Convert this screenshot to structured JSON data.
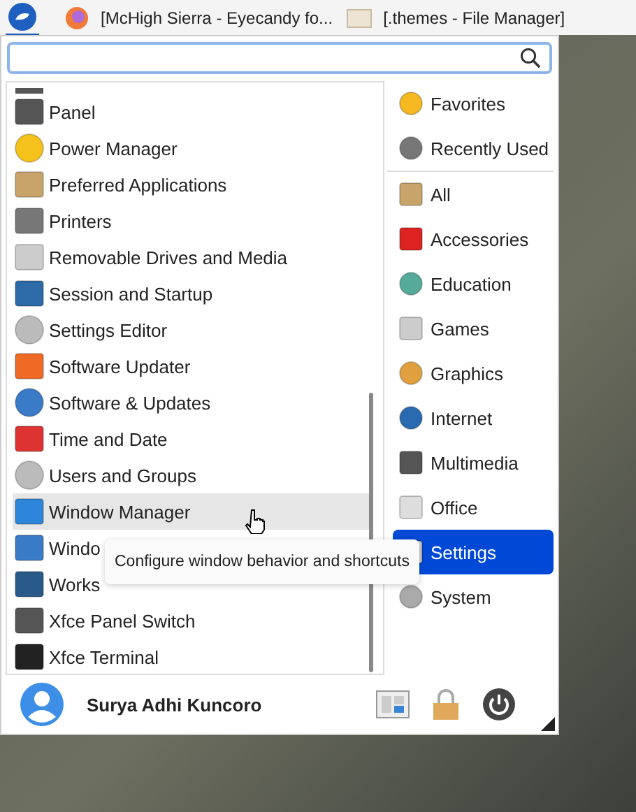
{
  "taskbar": {
    "windows": [
      {
        "title": "[McHigh Sierra - Eyecandy fo..."
      },
      {
        "title": "[.themes - File Manager]"
      }
    ]
  },
  "search": {
    "focused": true
  },
  "apps": [
    {
      "label": "Panel",
      "hovered": false
    },
    {
      "label": "Power Manager",
      "hovered": false
    },
    {
      "label": "Preferred Applications",
      "hovered": false
    },
    {
      "label": "Printers",
      "hovered": false
    },
    {
      "label": "Removable Drives and Media",
      "hovered": false
    },
    {
      "label": "Session and Startup",
      "hovered": false
    },
    {
      "label": "Settings Editor",
      "hovered": false
    },
    {
      "label": "Software Updater",
      "hovered": false
    },
    {
      "label": "Software & Updates",
      "hovered": false
    },
    {
      "label": "Time and Date",
      "hovered": false
    },
    {
      "label": "Users and Groups",
      "hovered": false
    },
    {
      "label": "Window Manager",
      "hovered": true
    },
    {
      "label": "Windo",
      "hovered": false
    },
    {
      "label": "Works",
      "hovered": false
    },
    {
      "label": "Xfce Panel Switch",
      "hovered": false
    },
    {
      "label": "Xfce Terminal",
      "hovered": false
    }
  ],
  "tooltip": "Configure window behavior and shortcuts",
  "categories": [
    {
      "label": "Favorites",
      "selected": false
    },
    {
      "label": "Recently Used",
      "selected": false
    },
    {
      "label": "All",
      "selected": false
    },
    {
      "label": "Accessories",
      "selected": false
    },
    {
      "label": "Education",
      "selected": false
    },
    {
      "label": "Games",
      "selected": false
    },
    {
      "label": "Graphics",
      "selected": false
    },
    {
      "label": "Internet",
      "selected": false
    },
    {
      "label": "Multimedia",
      "selected": false
    },
    {
      "label": "Office",
      "selected": false
    },
    {
      "label": "Settings",
      "selected": true
    },
    {
      "label": "System",
      "selected": false
    }
  ],
  "user": {
    "name": "Surya Adhi Kuncoro"
  }
}
